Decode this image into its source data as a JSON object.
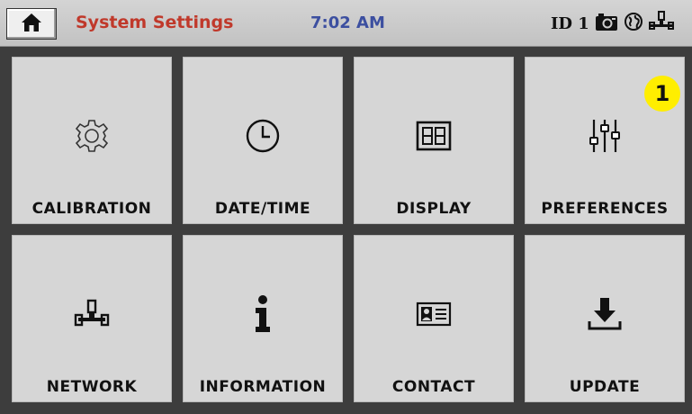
{
  "header": {
    "title": "System Settings",
    "time": "7:02 AM",
    "id_label": "ID 1",
    "icons": [
      "home-icon",
      "camera-icon",
      "globe-icon",
      "network-icon"
    ]
  },
  "tiles": [
    {
      "label": "CALIBRATION",
      "icon": "gear-icon"
    },
    {
      "label": "DATE/TIME",
      "icon": "clock-icon"
    },
    {
      "label": "DISPLAY",
      "icon": "display-icon"
    },
    {
      "label": "PREFERENCES",
      "icon": "sliders-icon"
    },
    {
      "label": "NETWORK",
      "icon": "network-icon"
    },
    {
      "label": "INFORMATION",
      "icon": "info-icon"
    },
    {
      "label": "CONTACT",
      "icon": "contact-card-icon"
    },
    {
      "label": "UPDATE",
      "icon": "download-icon"
    }
  ],
  "callout": {
    "number": "1"
  },
  "colors": {
    "title": "#c0392b",
    "time": "#3c4fa0",
    "tile": "#d6d6d6",
    "background": "#3d3d3d",
    "callout": "#ffee00"
  }
}
